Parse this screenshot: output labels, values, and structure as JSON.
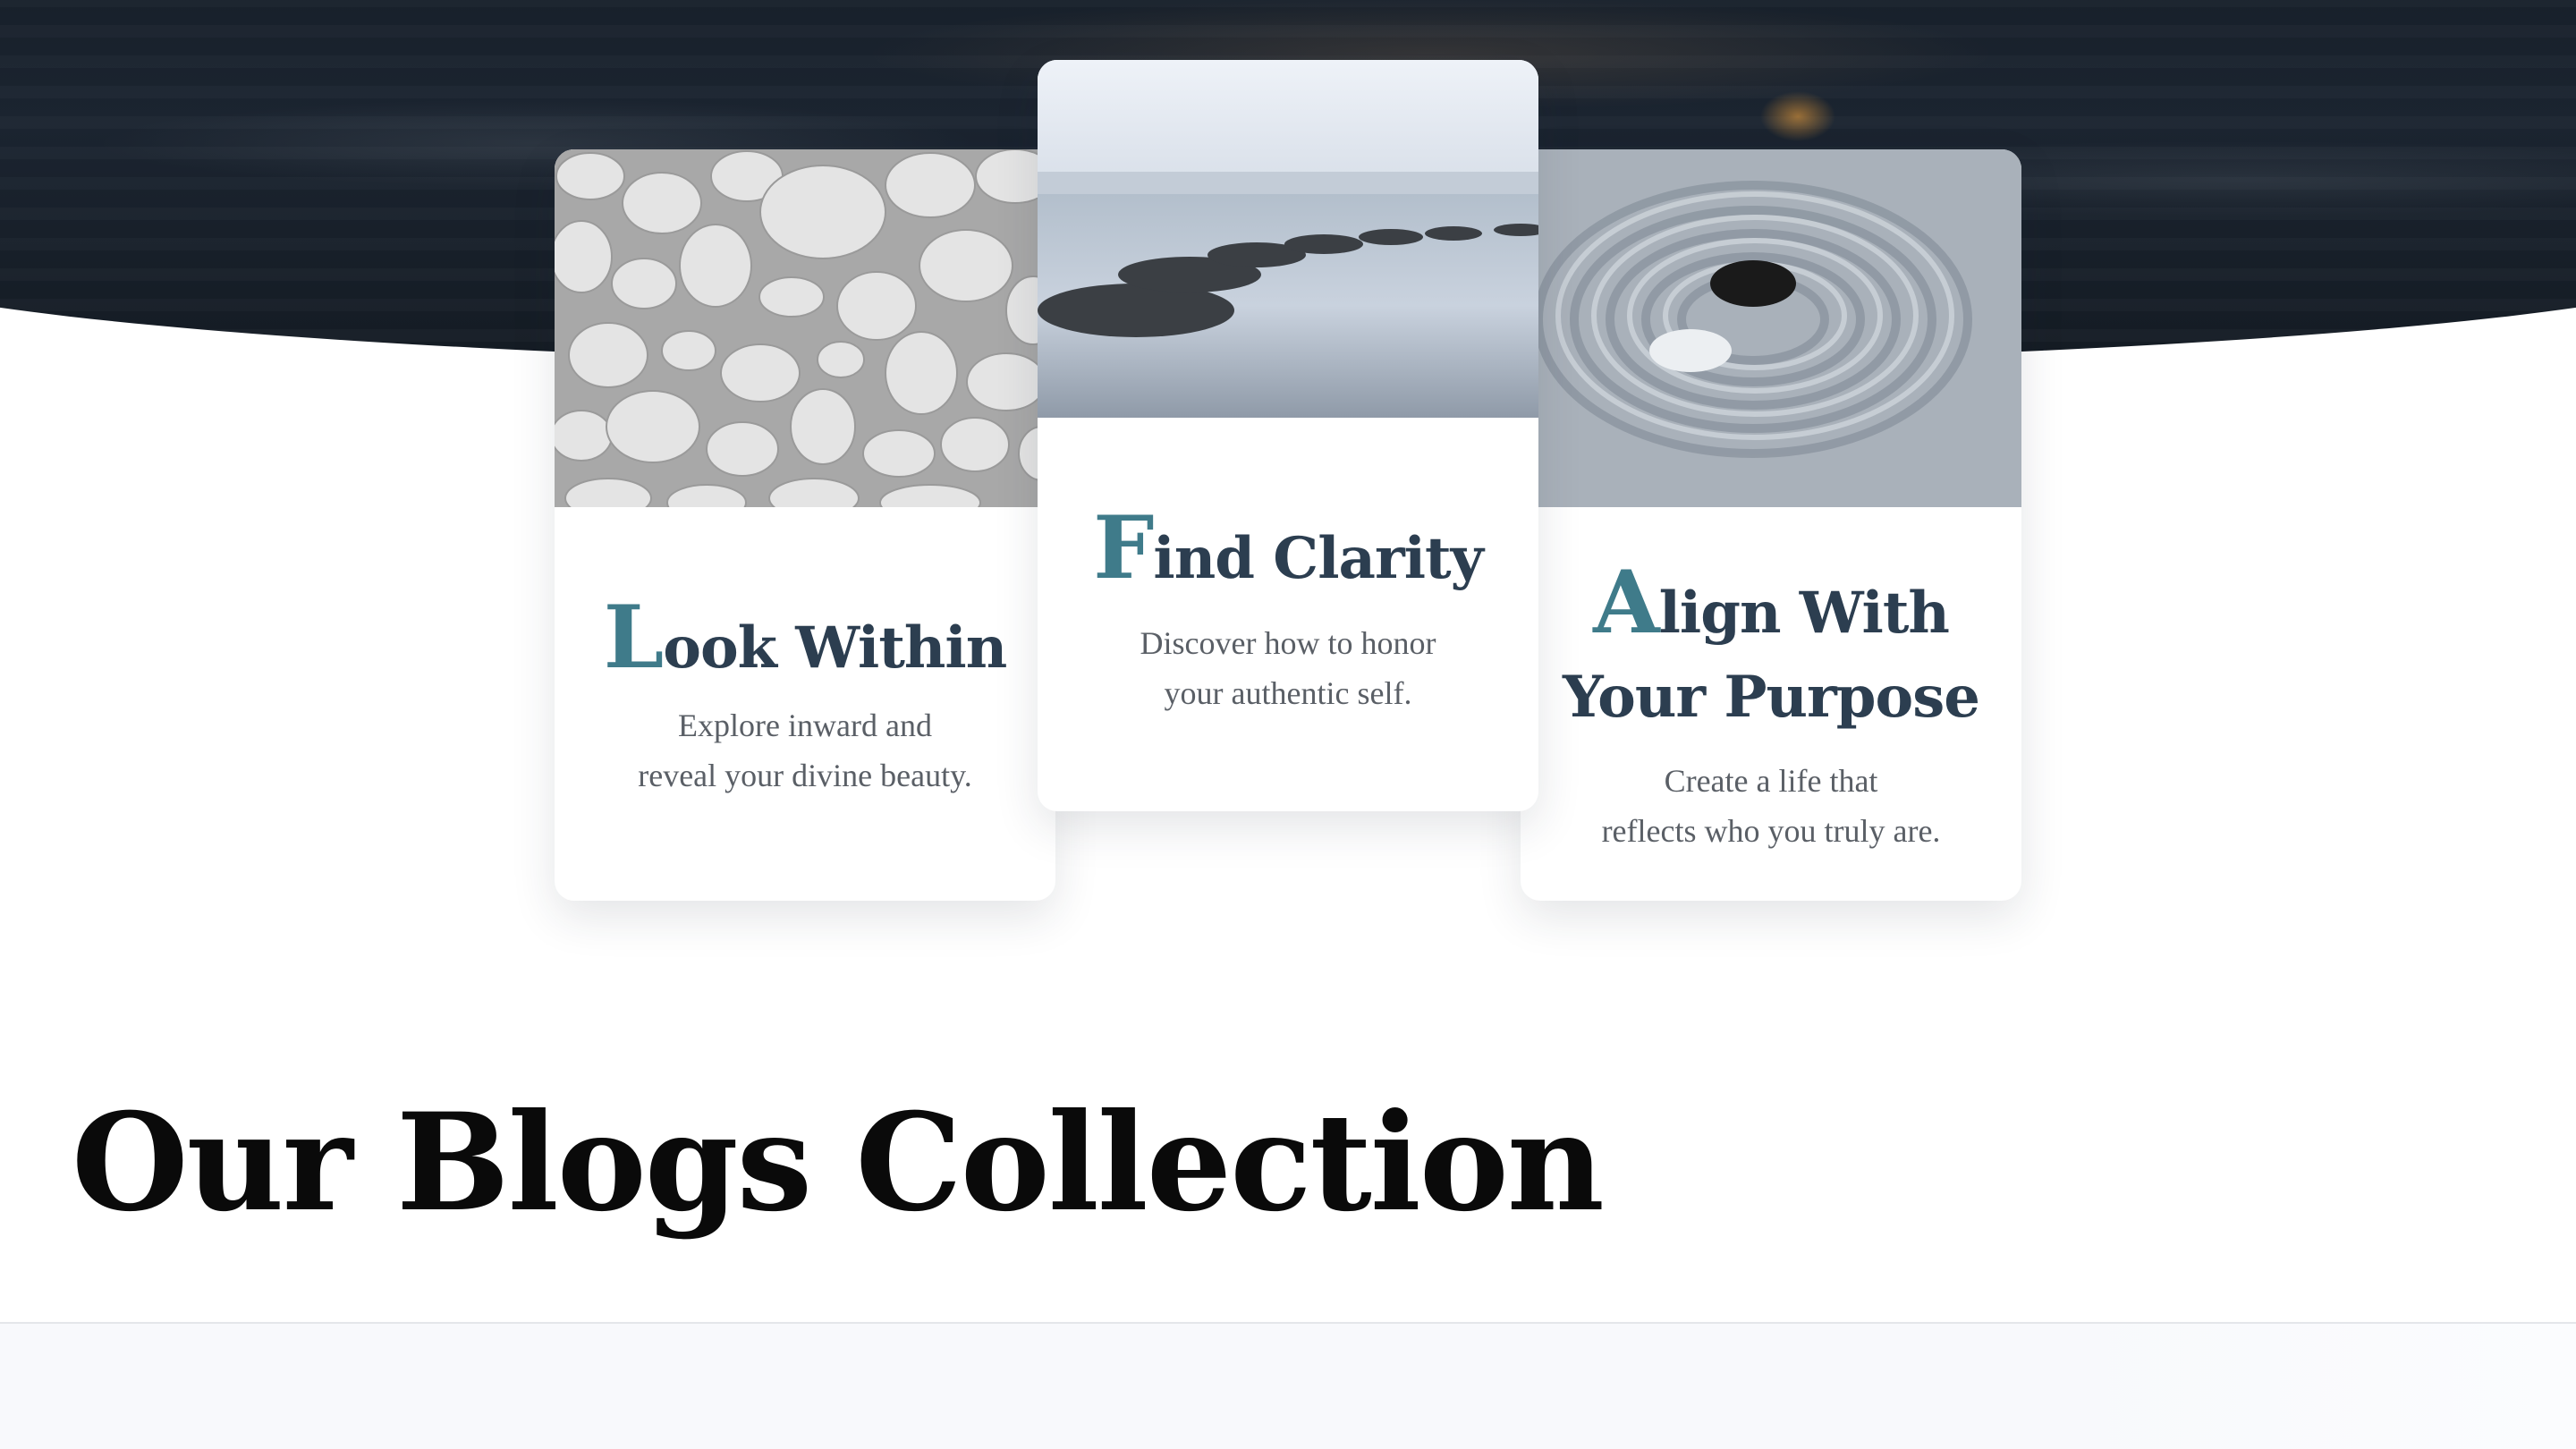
{
  "features": [
    {
      "id": "look",
      "title_initial": "L",
      "title_rest": "ook Within",
      "text_line1": "Explore inward and",
      "text_line2": "reveal your divine beauty.",
      "image": "white-pebbles"
    },
    {
      "id": "find",
      "title_initial": "F",
      "title_rest": "ind Clarity",
      "text_line1": "Discover how to honor",
      "text_line2": "your authentic self.",
      "image": "stepping-stones-on-water"
    },
    {
      "id": "align",
      "title_initial": "A",
      "title_rest": "lign With",
      "title_line2": "Your Purpose",
      "text_line1": "Create a life that",
      "text_line2": "reflects who you truly are.",
      "image": "zen-sand-yin-yang-stones"
    }
  ],
  "blogs": {
    "heading": "Our Blogs Collection"
  },
  "colors": {
    "accent_initial": "#3f7b8a",
    "title": "#2c3e50",
    "body_text": "#5a5f66",
    "hero_dark": "#151d26"
  }
}
